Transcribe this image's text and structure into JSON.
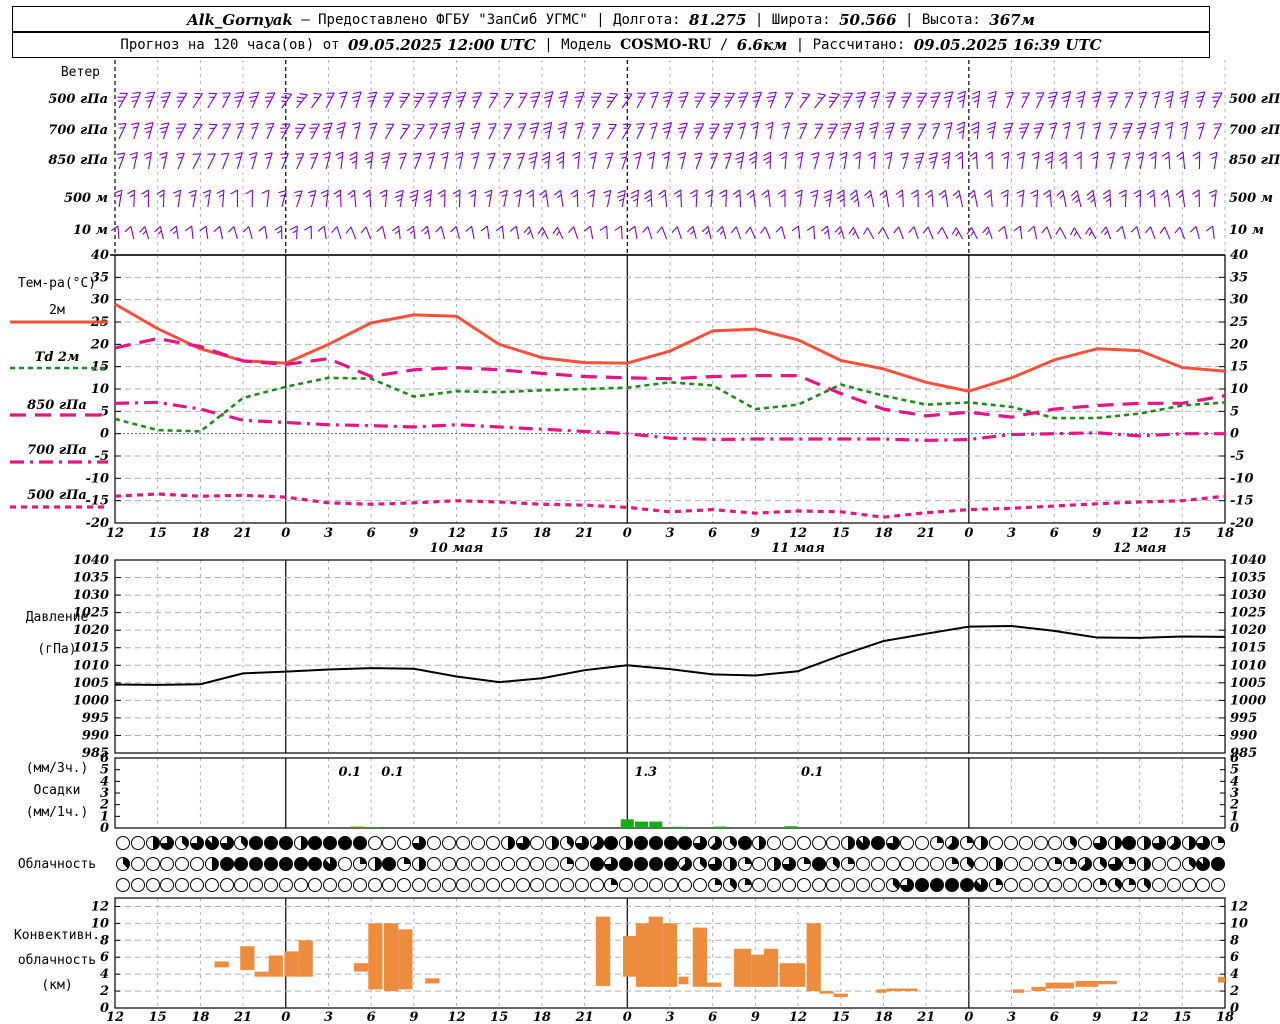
{
  "header": {
    "line1": [
      {
        "t": "Alk_Gornyak",
        "s": "val"
      },
      {
        "t": " – Предоставлено ФГБУ \"ЗапСиб УГМС\" | Долгота: "
      },
      {
        "t": "81.275",
        "s": "val"
      },
      {
        "t": " | Широта: "
      },
      {
        "t": "50.566",
        "s": "val"
      },
      {
        "t": " | Высота: "
      },
      {
        "t": "367м",
        "s": "val"
      }
    ],
    "line2": [
      {
        "t": "Прогноз на 120 часа(ов) от "
      },
      {
        "t": "09.05.2025 12:00 UTC",
        "s": "val"
      },
      {
        "t": " | Модель "
      },
      {
        "t": "COSMO-RU",
        "s": "mdl"
      },
      {
        "t": " / "
      },
      {
        "t": "6.6км",
        "s": "val"
      },
      {
        "t": " | Рассчитано: "
      },
      {
        "t": "09.05.2025 16:39 UTC",
        "s": "val"
      }
    ]
  },
  "axis": {
    "hours_total": 78,
    "hour_labels": [
      "12",
      "15",
      "18",
      "21",
      "0",
      "3",
      "6",
      "9",
      "12",
      "15",
      "18",
      "21",
      "0",
      "3",
      "6",
      "9",
      "12",
      "15",
      "18",
      "21",
      "0",
      "3",
      "6",
      "9",
      "12",
      "15",
      "18"
    ],
    "day_labels": [
      {
        "label": "10 мая",
        "hour": 24
      },
      {
        "label": "11 мая",
        "hour": 48
      },
      {
        "label": "12 мая",
        "hour": 72
      }
    ],
    "midnight_hours": [
      12,
      36,
      60
    ]
  },
  "panels": {
    "wind": {
      "title": "Ветер",
      "levels": [
        "500 гПа",
        "700 гПа",
        "850 гПа",
        "500 м",
        "10 м"
      ]
    },
    "temperature": {
      "legend_title": "Тем-ра(°C)",
      "legend": [
        "2м",
        "Td 2м",
        "850 гПа",
        "700 гПа",
        "500 гПа"
      ],
      "yticks": [
        40,
        35,
        30,
        25,
        20,
        15,
        10,
        5,
        0,
        -5,
        -10,
        -15,
        -20
      ]
    },
    "pressure": {
      "label_lines": [
        "Давление",
        "(гПа)"
      ],
      "yticks": [
        1040,
        1035,
        1030,
        1025,
        1020,
        1015,
        1010,
        1005,
        1000,
        995,
        990,
        985
      ]
    },
    "precip": {
      "label_lines": [
        "(мм/3ч.)",
        "Осадки",
        "(мм/1ч.)"
      ],
      "yticks": [
        6,
        5,
        4,
        3,
        2,
        1,
        0
      ]
    },
    "cloud": {
      "label": "Облачность"
    },
    "convective": {
      "label_lines": [
        "Конвективн.",
        "облачность",
        "(км)"
      ],
      "yticks": [
        12,
        10,
        8,
        6,
        4,
        2,
        0
      ]
    }
  },
  "colors": {
    "t2m": "#f8503a",
    "td2m": "#1d8a1d",
    "t850": "#e51585",
    "t700": "#e51585",
    "t500": "#e51585",
    "zero_line": "#4466ff",
    "pressure": "#000000",
    "precip_bar": "#10b010",
    "conv_bar": "#ee8c3e",
    "wind_barb": "#8000cc",
    "grid": "#b0b0b0",
    "midnight": "#000000"
  },
  "chart_data": [
    {
      "type": "line",
      "name": "temperature",
      "title": "Тем-ра(°C)",
      "x_hours_step": 3,
      "ylim": [
        -20,
        40
      ],
      "series": [
        {
          "name": "2м",
          "values": [
            29,
            23.5,
            19,
            16.3,
            15.8,
            20,
            24.8,
            26.6,
            26.3,
            20,
            17,
            15.9,
            15.8,
            18.5,
            23,
            23.4,
            21,
            16.4,
            14.5,
            11.5,
            9.5,
            12.5,
            16.5,
            19,
            18.6,
            14.8,
            14
          ]
        },
        {
          "name": "Td 2м",
          "values": [
            3.3,
            0.8,
            0.5,
            8,
            10.5,
            12.5,
            12.3,
            8.3,
            9.5,
            9.3,
            9.7,
            10,
            10.3,
            11.5,
            10.8,
            5.5,
            6.5,
            11,
            8.5,
            6.5,
            7,
            6,
            3.5,
            3.5,
            4.5,
            6.3,
            7
          ]
        },
        {
          "name": "850 гПа",
          "values": [
            19.2,
            21.3,
            19.5,
            16.3,
            15.5,
            16.8,
            12.8,
            14.3,
            14.8,
            14.3,
            13.5,
            12.8,
            12.5,
            12.3,
            12.8,
            13,
            13,
            9,
            5.5,
            4,
            4.8,
            3.7,
            5.5,
            6.3,
            6.8,
            6.8,
            8.5
          ]
        },
        {
          "name": "700 гПа",
          "values": [
            6.8,
            7,
            5.5,
            3,
            2.5,
            2,
            1.8,
            1.5,
            2,
            1.5,
            1,
            0.5,
            0,
            -1,
            -1.3,
            -1.2,
            -1.2,
            -1.2,
            -1.2,
            -1.5,
            -1.3,
            -0.2,
            0,
            0.2,
            -0.5,
            0,
            0
          ]
        },
        {
          "name": "500 гПа",
          "values": [
            -14,
            -13.5,
            -14,
            -13.8,
            -14.2,
            -15.5,
            -15.8,
            -15.5,
            -15,
            -15.3,
            -15.8,
            -16,
            -16.5,
            -17.5,
            -17,
            -17.8,
            -17.3,
            -17.5,
            -18.7,
            -17.7,
            -17,
            -16.7,
            -16.2,
            -15.7,
            -15.3,
            -15,
            -14
          ]
        }
      ]
    },
    {
      "type": "line",
      "name": "pressure",
      "title": "Давление (гПа)",
      "x_hours_step": 3,
      "ylim": [
        985,
        1040
      ],
      "values": [
        1004.5,
        1004.4,
        1004.6,
        1007.7,
        1008.2,
        1008.8,
        1009.2,
        1009.0,
        1006.8,
        1005.2,
        1006.3,
        1008.6,
        1010.0,
        1008.9,
        1007.4,
        1007.1,
        1008.3,
        1012.8,
        1016.9,
        1019.0,
        1021.0,
        1021.2,
        1019.8,
        1017.9,
        1017.8,
        1018.2,
        1018.1
      ]
    },
    {
      "type": "bar",
      "name": "precipitation",
      "title": "Осадки (мм/3ч.) (мм/1ч.)",
      "ylim": [
        0,
        6
      ],
      "bars": [
        {
          "h": 17,
          "v": 0.12
        },
        {
          "h": 18,
          "v": 0.08
        },
        {
          "h": 36,
          "v": 0.75
        },
        {
          "h": 37,
          "v": 0.55
        },
        {
          "h": 38,
          "v": 0.55
        },
        {
          "h": 39.5,
          "v": 0.1
        },
        {
          "h": 42.5,
          "v": 0.12
        },
        {
          "h": 47.5,
          "v": 0.15
        }
      ],
      "value_labels": [
        {
          "h": 16.5,
          "text": "0.1"
        },
        {
          "h": 19.5,
          "text": "0.1"
        },
        {
          "h": 37.3,
          "text": "1.3"
        },
        {
          "h": 49,
          "text": "0.1"
        }
      ]
    },
    {
      "type": "heatmap",
      "name": "cloud-cover",
      "title": "Облачность",
      "note": "three rows of hourly cloud-cover circles, fill in eighths 0-8",
      "rows": [
        [
          0,
          0,
          4,
          6,
          3,
          6,
          7,
          6,
          3,
          8,
          8,
          8,
          4,
          8,
          8,
          8,
          8,
          0,
          0,
          0,
          6,
          0,
          0,
          0,
          0,
          0,
          4,
          6,
          0,
          4,
          3,
          6,
          5,
          8,
          4,
          8,
          8,
          8,
          8,
          6,
          5,
          3,
          8,
          4,
          0,
          0,
          0,
          0,
          0,
          4,
          7,
          8,
          6,
          0,
          0,
          2,
          5,
          2,
          4,
          0,
          0,
          0,
          0,
          0,
          3,
          0,
          6,
          4,
          8,
          4,
          6,
          5,
          4,
          6,
          2
        ],
        [
          3,
          0,
          0,
          0,
          0,
          0,
          4,
          8,
          8,
          8,
          8,
          8,
          8,
          8,
          7,
          0,
          2,
          4,
          8,
          2,
          4,
          0,
          0,
          0,
          0,
          0,
          0,
          0,
          0,
          0,
          2,
          0,
          8,
          6,
          8,
          8,
          8,
          8,
          5,
          3,
          6,
          4,
          2,
          0,
          4,
          6,
          2,
          8,
          3,
          2,
          0,
          0,
          0,
          0,
          0,
          0,
          2,
          3,
          0,
          4,
          0,
          0,
          0,
          2,
          2,
          5,
          3,
          6,
          2,
          4,
          0,
          0,
          3,
          7,
          8
        ],
        [
          0,
          0,
          0,
          0,
          0,
          0,
          0,
          0,
          0,
          0,
          0,
          0,
          0,
          0,
          0,
          0,
          0,
          0,
          0,
          0,
          0,
          0,
          0,
          0,
          0,
          0,
          0,
          0,
          0,
          0,
          0,
          0,
          0,
          2,
          0,
          0,
          0,
          0,
          0,
          0,
          2,
          3,
          2,
          0,
          0,
          0,
          0,
          0,
          0,
          0,
          0,
          0,
          3,
          6,
          8,
          8,
          8,
          8,
          7,
          2,
          0,
          0,
          0,
          0,
          0,
          0,
          2,
          3,
          2,
          3,
          0,
          0,
          0,
          0,
          0
        ]
      ]
    },
    {
      "type": "bar",
      "name": "convective-cloud-km",
      "title": "Конвективн. облачность (км)",
      "ylim": [
        0,
        13
      ],
      "range_bars": [
        {
          "h": 7,
          "b": 4.8,
          "t": 5.5
        },
        {
          "h": 8.8,
          "b": 4.5,
          "t": 7.3
        },
        {
          "h": 9.8,
          "b": 3.7,
          "t": 4.3
        },
        {
          "h": 10.8,
          "b": 3.7,
          "t": 6.2
        },
        {
          "h": 11.9,
          "b": 3.7,
          "t": 6.7
        },
        {
          "h": 12.9,
          "b": 3.7,
          "t": 8
        },
        {
          "h": 16.8,
          "b": 4.3,
          "t": 5.3
        },
        {
          "h": 17.8,
          "b": 2.2,
          "t": 10
        },
        {
          "h": 18.9,
          "b": 2,
          "t": 10
        },
        {
          "h": 19.9,
          "b": 2.2,
          "t": 9.3
        },
        {
          "h": 21.8,
          "b": 2.9,
          "t": 3.5
        },
        {
          "h": 33.8,
          "b": 2.6,
          "t": 10.8
        },
        {
          "h": 35.7,
          "b": 3.7,
          "t": 8.5
        },
        {
          "h": 36.6,
          "b": 2.5,
          "t": 10
        },
        {
          "h": 37.5,
          "b": 2.5,
          "t": 10.8
        },
        {
          "h": 38.5,
          "b": 2.5,
          "t": 10
        },
        {
          "h": 39.6,
          "b": 2.8,
          "t": 3.7,
          "w": 0.7
        },
        {
          "h": 40.6,
          "b": 2.5,
          "t": 9.5
        },
        {
          "h": 41.6,
          "b": 2.5,
          "t": 3
        },
        {
          "h": 43.5,
          "b": 2.5,
          "t": 7,
          "w": 1.2
        },
        {
          "h": 44.7,
          "b": 2.5,
          "t": 6.3
        },
        {
          "h": 45.6,
          "b": 2.5,
          "t": 7
        },
        {
          "h": 46.7,
          "b": 2.5,
          "t": 5.3,
          "w": 0.8
        },
        {
          "h": 47.5,
          "b": 2.5,
          "t": 5.3
        },
        {
          "h": 48.6,
          "b": 2,
          "t": 10
        },
        {
          "h": 49.5,
          "b": 1.7,
          "t": 2
        },
        {
          "h": 50.5,
          "b": 1.3,
          "t": 1.7
        },
        {
          "h": 53.5,
          "b": 1.8,
          "t": 2.2,
          "w": 0.7
        },
        {
          "h": 54.2,
          "b": 2,
          "t": 2.3,
          "w": 2.2
        },
        {
          "h": 63.1,
          "b": 1.8,
          "t": 2.2,
          "w": 0.8
        },
        {
          "h": 64.4,
          "b": 2,
          "t": 2.5
        },
        {
          "h": 65.4,
          "b": 2.3,
          "t": 3,
          "w": 2
        },
        {
          "h": 67.5,
          "b": 2.5,
          "t": 3.2,
          "w": 1.6
        },
        {
          "h": 69.1,
          "b": 2.8,
          "t": 3.2,
          "w": 1.3
        },
        {
          "h": 77.5,
          "b": 3,
          "t": 3.7,
          "w": 0.5
        }
      ]
    },
    {
      "type": "wind-barbs",
      "name": "wind",
      "title": "Ветер",
      "x_hours_step": 3,
      "rows": [
        {
          "level": "500 гПа",
          "dirs": [
            60,
            62,
            65,
            60,
            58,
            62,
            66,
            63,
            60,
            64,
            68,
            64,
            60,
            63,
            66,
            62,
            58,
            60,
            64,
            70,
            75,
            72,
            68,
            70,
            74,
            70,
            66
          ],
          "speeds": [
            3,
            3,
            2,
            3,
            3,
            2,
            3,
            3,
            3,
            2,
            3,
            3,
            2,
            3,
            3,
            3,
            2,
            3,
            3,
            3,
            3,
            2,
            3,
            3,
            2,
            3,
            3
          ]
        },
        {
          "level": "700 гПа",
          "dirs": [
            65,
            68,
            64,
            60,
            66,
            70,
            65,
            62,
            66,
            70,
            72,
            68,
            64,
            66,
            70,
            74,
            70,
            66,
            68,
            72,
            78,
            74,
            70,
            72,
            76,
            72,
            68
          ],
          "speeds": [
            2,
            3,
            2,
            2,
            3,
            3,
            2,
            2,
            3,
            2,
            3,
            2,
            2,
            3,
            3,
            2,
            2,
            3,
            3,
            2,
            3,
            3,
            2,
            2,
            3,
            2,
            2
          ]
        },
        {
          "level": "850 гПа",
          "dirs": [
            70,
            74,
            70,
            66,
            72,
            76,
            80,
            74,
            70,
            74,
            78,
            82,
            76,
            72,
            76,
            80,
            84,
            80,
            76,
            80,
            86,
            90,
            84,
            80,
            84,
            88,
            84
          ],
          "speeds": [
            2,
            2,
            1,
            2,
            2,
            2,
            3,
            2,
            2,
            2,
            3,
            2,
            2,
            2,
            2,
            3,
            2,
            2,
            2,
            3,
            2,
            2,
            3,
            2,
            2,
            2,
            2
          ]
        },
        {
          "level": "500 м",
          "dirs": [
            80,
            84,
            88,
            82,
            78,
            84,
            90,
            86,
            80,
            86,
            92,
            88,
            84,
            88,
            94,
            90,
            86,
            90,
            96,
            100,
            94,
            90,
            94,
            98,
            94,
            90,
            86
          ],
          "speeds": [
            2,
            2,
            2,
            1,
            2,
            2,
            2,
            3,
            2,
            2,
            2,
            2,
            3,
            2,
            2,
            2,
            2,
            3,
            2,
            2,
            2,
            2,
            2,
            3,
            2,
            2,
            2
          ]
        },
        {
          "level": "10 м",
          "dirs": [
            95,
            100,
            105,
            98,
            94,
            100,
            108,
            102,
            96,
            104,
            110,
            104,
            98,
            104,
            112,
            106,
            100,
            106,
            114,
            118,
            110,
            104,
            110,
            116,
            110,
            104,
            100
          ],
          "speeds": [
            1,
            2,
            1,
            1,
            2,
            1,
            1,
            2,
            1,
            1,
            2,
            1,
            1,
            1,
            2,
            1,
            1,
            2,
            1,
            1,
            2,
            1,
            1,
            2,
            1,
            1,
            1
          ]
        }
      ]
    }
  ]
}
